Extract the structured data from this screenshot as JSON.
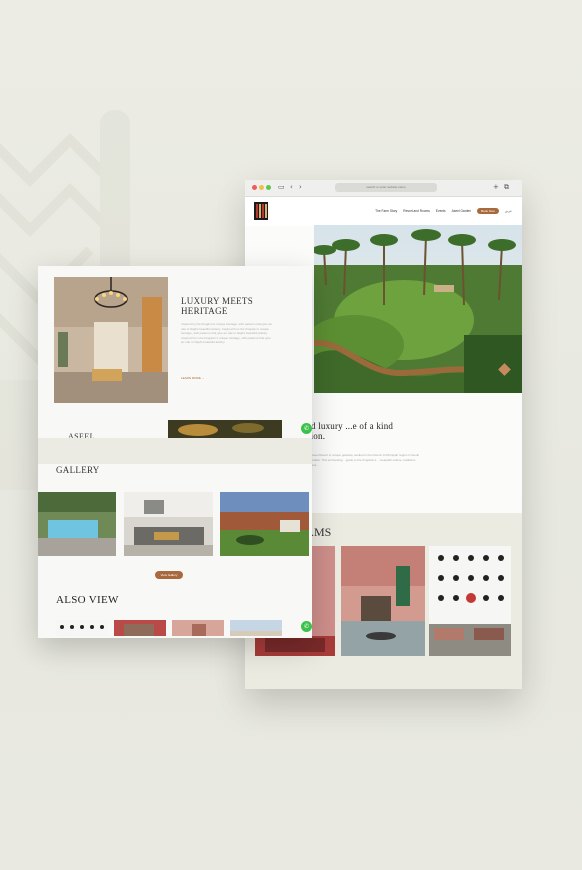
{
  "browser": {
    "address": "search or enter website name",
    "traffic_colors": [
      "#ef5e55",
      "#f3bd4f",
      "#61c554"
    ]
  },
  "site": {
    "nav_items": [
      "The Farm Story",
      "Resort and Rooms",
      "Events",
      "Aseel Garden"
    ],
    "book_label": "Book Now",
    "lang_label": "عربي"
  },
  "about": {
    "heading": "...ge, and luxury ...e of a kind destination.",
    "body": "Aseel Resort is unique getaway nestled in the historic Al Dhirayah region in South Arabia. This enchanting... guide to the Kingdom's ... beautiful culture, traditions and..."
  },
  "rooms": {
    "title": "...MS"
  },
  "card": {
    "lux_heading": "LUXURY MEETS HERITAGE",
    "lux_body": "Inspired by the Kingdom's unique heritage, with patterns that give an ode to Najd's beautiful artistry. Inspired from the Kingdom's unique heritage, with patterns that give an ode to Najd's beautiful artistry. Inspired from the Kingdom's unique heritage, with patterns that give an ode to Najd's beautiful artistry.",
    "lux_more": "LEARN MORE →",
    "aseel_label": "ASEEL",
    "gallery_title": "GALLERY",
    "gallery_button": "View Gallery",
    "also_title": "ALSO VIEW"
  },
  "colors": {
    "accent": "#a86a3c",
    "diamond": "#c68a5e",
    "whatsapp": "#3cc24c"
  },
  "icons": [
    "back-icon",
    "forward-icon",
    "plus-icon",
    "tabs-icon",
    "whatsapp-icon"
  ]
}
